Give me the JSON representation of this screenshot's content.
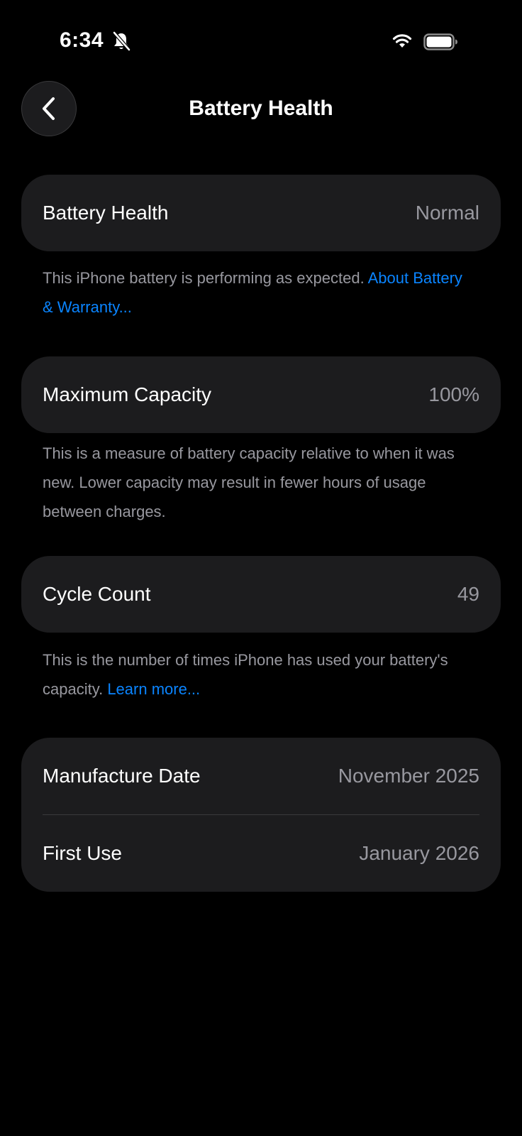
{
  "status_bar": {
    "time": "6:34",
    "icons": [
      "bell-slash-icon",
      "wifi-icon",
      "battery-icon"
    ]
  },
  "nav": {
    "back_icon": "chevron-left-icon",
    "title": "Battery Health"
  },
  "health": {
    "label": "Battery Health",
    "value": "Normal",
    "note": "This iPhone battery is performing as expected.",
    "link": "About Battery & Warranty..."
  },
  "capacity": {
    "label": "Maximum Capacity",
    "value": "100%",
    "note": "This is a measure of battery capacity relative to when it was new. Lower capacity may result in fewer hours of usage between charges."
  },
  "cycles": {
    "label": "Cycle Count",
    "value": "49",
    "note": "This is the number of times iPhone has used your battery's capacity.",
    "link": "Learn more..."
  },
  "dates": {
    "manufacture_label": "Manufacture Date",
    "manufacture_value": "November 2025",
    "first_use_label": "First Use",
    "first_use_value": "January 2026"
  },
  "colors": {
    "background": "#000000",
    "card": "#1c1c1e",
    "secondary_text": "#98989f",
    "link": "#0a84ff"
  }
}
